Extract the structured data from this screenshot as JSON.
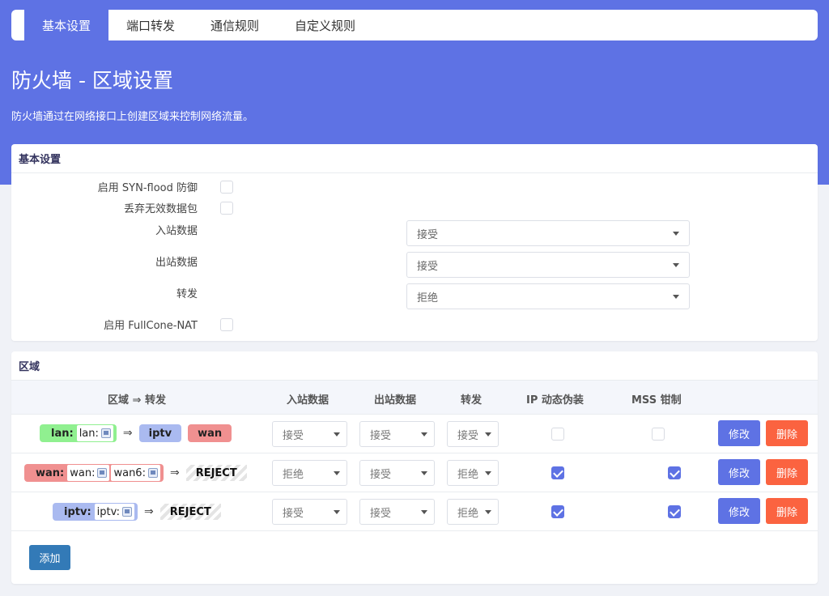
{
  "tabs": [
    {
      "label": "基本设置"
    },
    {
      "label": "端口转发"
    },
    {
      "label": "通信规则"
    },
    {
      "label": "自定义规则"
    }
  ],
  "page": {
    "title": "防火墙 - 区域设置",
    "description": "防火墙通过在网络接口上创建区域来控制网络流量。"
  },
  "basic": {
    "header": "基本设置",
    "syn_flood_label": "启用 SYN-flood 防御",
    "syn_flood_checked": false,
    "drop_invalid_label": "丢弃无效数据包",
    "drop_invalid_checked": false,
    "input_label": "入站数据",
    "input_value": "接受",
    "output_label": "出站数据",
    "output_value": "接受",
    "forward_label": "转发",
    "forward_value": "拒绝",
    "fullcone_label": "启用 FullCone-NAT",
    "fullcone_checked": false
  },
  "zones": {
    "header": "区域",
    "columns": {
      "zone_forward": "区域 ⇒ 转发",
      "input": "入站数据",
      "output": "出站数据",
      "forward": "转发",
      "masq": "IP 动态伪装",
      "mss": "MSS 钳制"
    },
    "arrow": "⇒",
    "rows": [
      {
        "zone": "lan:",
        "devices": [
          "lan:"
        ],
        "destinations": [
          "iptv",
          "wan"
        ],
        "input": "接受",
        "output": "接受",
        "forward": "接受",
        "masq": false,
        "mss": false
      },
      {
        "zone": "wan:",
        "devices": [
          "wan:",
          "wan6:"
        ],
        "reject_label": "REJECT",
        "input": "拒绝",
        "output": "接受",
        "forward": "拒绝",
        "masq": true,
        "mss": true
      },
      {
        "zone": "iptv:",
        "devices": [
          "iptv:"
        ],
        "reject_label": "REJECT",
        "input": "接受",
        "output": "接受",
        "forward": "拒绝",
        "masq": true,
        "mss": true
      }
    ],
    "edit_label": "修改",
    "delete_label": "删除",
    "add_label": "添加"
  },
  "colors": {
    "accent": "#5e72e4",
    "danger": "#fb6340",
    "zone_lan": "#90f090",
    "zone_wan": "#f09090",
    "zone_iptv": "#aabaf0"
  }
}
